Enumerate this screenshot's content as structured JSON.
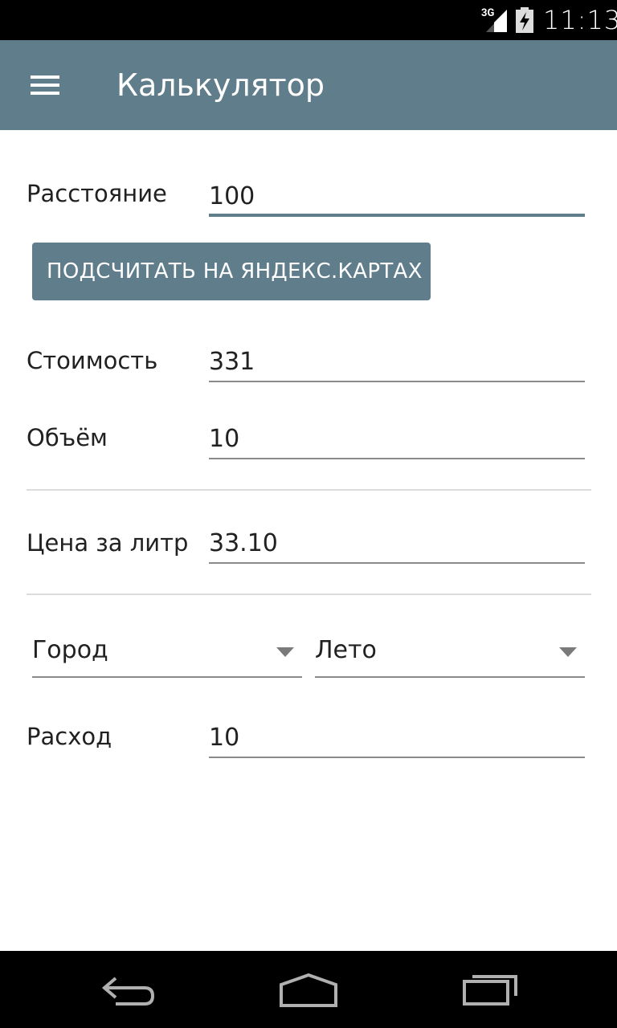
{
  "status_bar": {
    "network": "3G",
    "time": "11:13"
  },
  "app_bar": {
    "title": "Калькулятор",
    "menu_icon": "hamburger-menu-icon"
  },
  "form": {
    "distance": {
      "label": "Расстояние",
      "value": "100"
    },
    "yandex_button": {
      "label": "ПОДСЧИТАТЬ НА ЯНДЕКС.КАРТАХ"
    },
    "cost": {
      "label": "Стоимость",
      "value": "331"
    },
    "volume": {
      "label": "Объём",
      "value": "10"
    },
    "price_per_liter": {
      "label": "Цена за литр",
      "value": "33.10"
    },
    "mode_select": {
      "selected": "Город"
    },
    "season_select": {
      "selected": "Лето"
    },
    "consumption": {
      "label": "Расход",
      "value": "10"
    }
  },
  "nav_bar": {
    "back_icon": "back-icon",
    "home_icon": "home-icon",
    "recents_icon": "recents-icon"
  },
  "colors": {
    "primary": "#607d8b",
    "status_bar": "#000000",
    "text": "#212121"
  }
}
